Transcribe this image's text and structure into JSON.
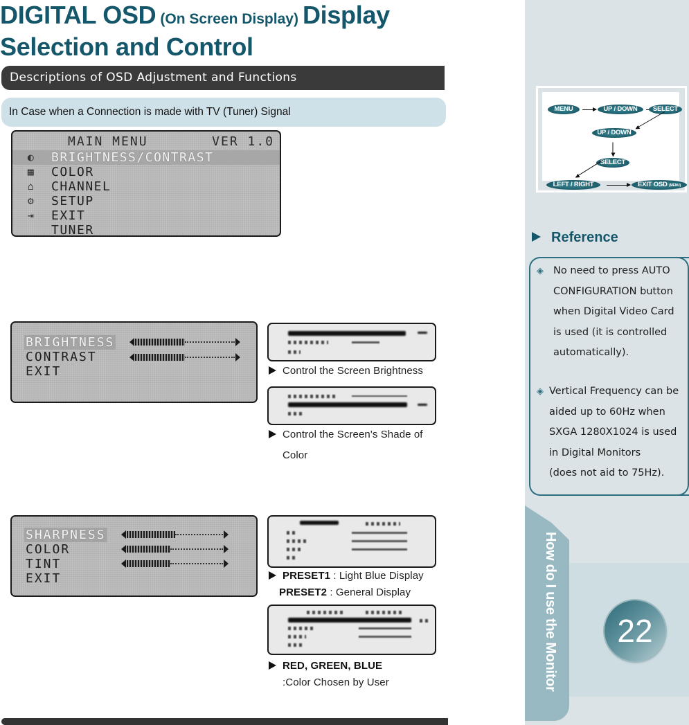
{
  "title": {
    "part1": "DIGITAL OSD",
    "part2": "(On Screen Display)",
    "part3": "Display",
    "line2": "Selection and Control"
  },
  "section_header": "Descriptions of OSD Adjustment and Functions",
  "case_label": "In Case when a Connection is made with TV (Tuner) Signal",
  "main_menu": {
    "heading": "MAIN MENU",
    "version": "VER 1.0",
    "items": [
      {
        "label": "BRIGHTNESS/CONTRAST",
        "icon": "brightness-icon",
        "glyph": "◐",
        "selected": true
      },
      {
        "label": "COLOR",
        "icon": "color-icon",
        "glyph": "▦",
        "selected": false
      },
      {
        "label": "CHANNEL",
        "icon": "tv-icon",
        "glyph": "⌂",
        "selected": false
      },
      {
        "label": "SETUP",
        "icon": "setup-icon",
        "glyph": "⚙",
        "selected": false
      },
      {
        "label": "EXIT",
        "icon": "exit-icon",
        "glyph": "⇥",
        "selected": false
      },
      {
        "label": "TUNER",
        "icon": "",
        "glyph": "",
        "selected": false
      }
    ]
  },
  "brightness_menu": {
    "items": [
      {
        "label": "BRIGHTNESS",
        "selected": true,
        "level": 0.5
      },
      {
        "label": "CONTRAST",
        "selected": false,
        "level": 0.5
      },
      {
        "label": "EXIT",
        "selected": false
      }
    ]
  },
  "picture_menu": {
    "items": [
      {
        "label": "SHARPNESS",
        "selected": true,
        "level": 0.5
      },
      {
        "label": "COLOR",
        "selected": false,
        "level": 0.45
      },
      {
        "label": "TINT",
        "selected": false,
        "level": 0.45
      },
      {
        "label": "EXIT",
        "selected": false
      }
    ]
  },
  "captions": {
    "brightness": "Control the Screen Brightness",
    "shade_line1": "Control the Screen's Shade of",
    "shade_line2": "Color",
    "preset1_key": "PRESET1",
    "preset1_value": " :  Light Blue Display",
    "preset2_key": "PRESET2",
    "preset2_value": " : General Display",
    "rgb_key": "RED, GREEN, BLUE",
    "rgb_value": ":Color Chosen by User"
  },
  "flow_diagram": {
    "nodes": {
      "menu": "MENU",
      "updown1": "UP / DOWN",
      "select1": "SELECT",
      "updown2": "UP / DOWN",
      "select2": "SELECT",
      "leftright": "LEFT / RIGHT",
      "exit": "EXIT OSD",
      "exit_sub": "(MENU)"
    }
  },
  "reference": {
    "title": "Reference",
    "items": [
      {
        "lines": [
          "No need to press AUTO",
          "CONFIGURATION button",
          "when Digital Video Card",
          "is used (it is controlled",
          "automatically)."
        ]
      },
      {
        "lines": [
          "Vertical Frequency can be",
          "aided up to 60Hz  when",
          "SXGA 1280X1024 is used",
          "in Digital Monitors",
          "(does not aid to 75Hz)."
        ]
      }
    ]
  },
  "side_tab": "How do I use the Monitor",
  "page_number": "22",
  "colors": {
    "brand": "#14566a",
    "section_bar": "#3a3a3a",
    "case_bar": "#cfe1e8",
    "sidebar": "#dbe3e6",
    "tab": "#98b9c1"
  }
}
